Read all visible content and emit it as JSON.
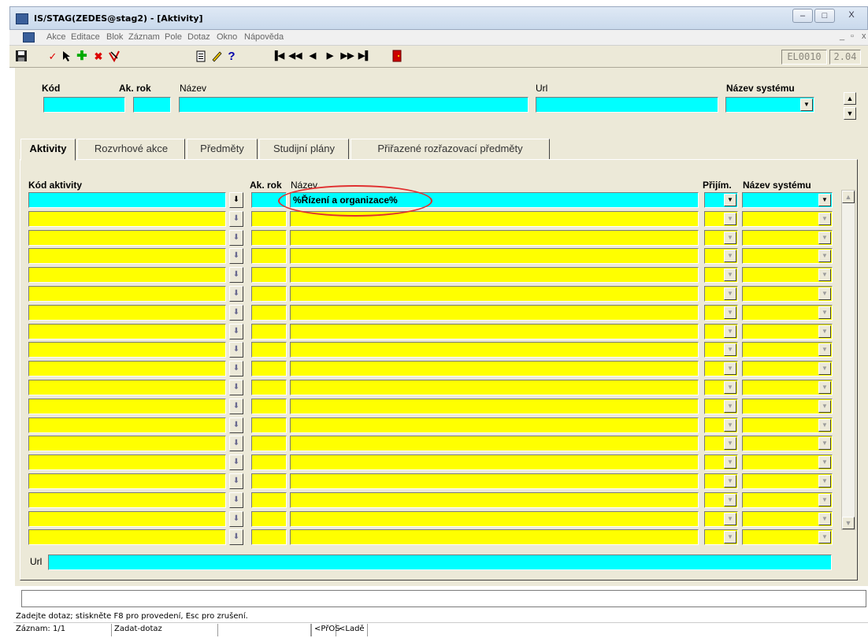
{
  "window": {
    "title": "IS/STAG(ZEDES@stag2) - [Aktivity]",
    "controls": [
      "–",
      "□",
      "X"
    ]
  },
  "menu": {
    "items": [
      "Akce",
      "Editace",
      "Blok",
      "Záznam",
      "Pole",
      "Dotaz",
      "Okno",
      "Nápověda"
    ]
  },
  "toolbar": {
    "form_code": "EL0010",
    "version": "2.04",
    "nav_glyphs": [
      "▐◀",
      "◀◀",
      "◀",
      "▶",
      "▶▶",
      "▶▌"
    ]
  },
  "header": {
    "kod_label": "Kód",
    "ak_rok_label": "Ak. rok",
    "nazev_label": "Název",
    "url_label": "Url",
    "nazev_systemu_label": "Název systému",
    "kod_value": "",
    "ak_rok_value": "",
    "nazev_value": "",
    "url_value": "",
    "nazev_systemu_value": ""
  },
  "tabs": [
    {
      "label": "Aktivity",
      "active": true
    },
    {
      "label": "Rozvrhové akce",
      "active": false
    },
    {
      "label": "Předměty",
      "active": false
    },
    {
      "label": "Studijní plány",
      "active": false
    },
    {
      "label": "Přiřazené rozřazovací předměty",
      "active": false
    }
  ],
  "grid": {
    "columns": {
      "kod_aktivity": "Kód aktivity",
      "ak_rok": "Ak. rok",
      "nazev": "Název",
      "prijim": "Přijím.",
      "nazev_systemu": "Název systému"
    },
    "row_count": 19,
    "query_row": {
      "kod_aktivity": "",
      "ak_rok": "",
      "nazev": "%Řízení a organizace%",
      "prijim": "",
      "nazev_systemu": ""
    }
  },
  "bottom": {
    "url_label": "Url",
    "url_value": ""
  },
  "status": {
    "hint": "Zadejte dotaz; stiskněte F8 pro provedení, Esc pro zrušení.",
    "record": "Záznam: 1/1",
    "mode": "Zadat-dotaz",
    "insert_mode": "<PřOS",
    "debug": "<Ladě"
  },
  "colors": {
    "query_field": "#00ffff",
    "data_field": "#ffff00",
    "form_bg": "#ece9d8",
    "highlight_ellipse": "#e03030"
  }
}
